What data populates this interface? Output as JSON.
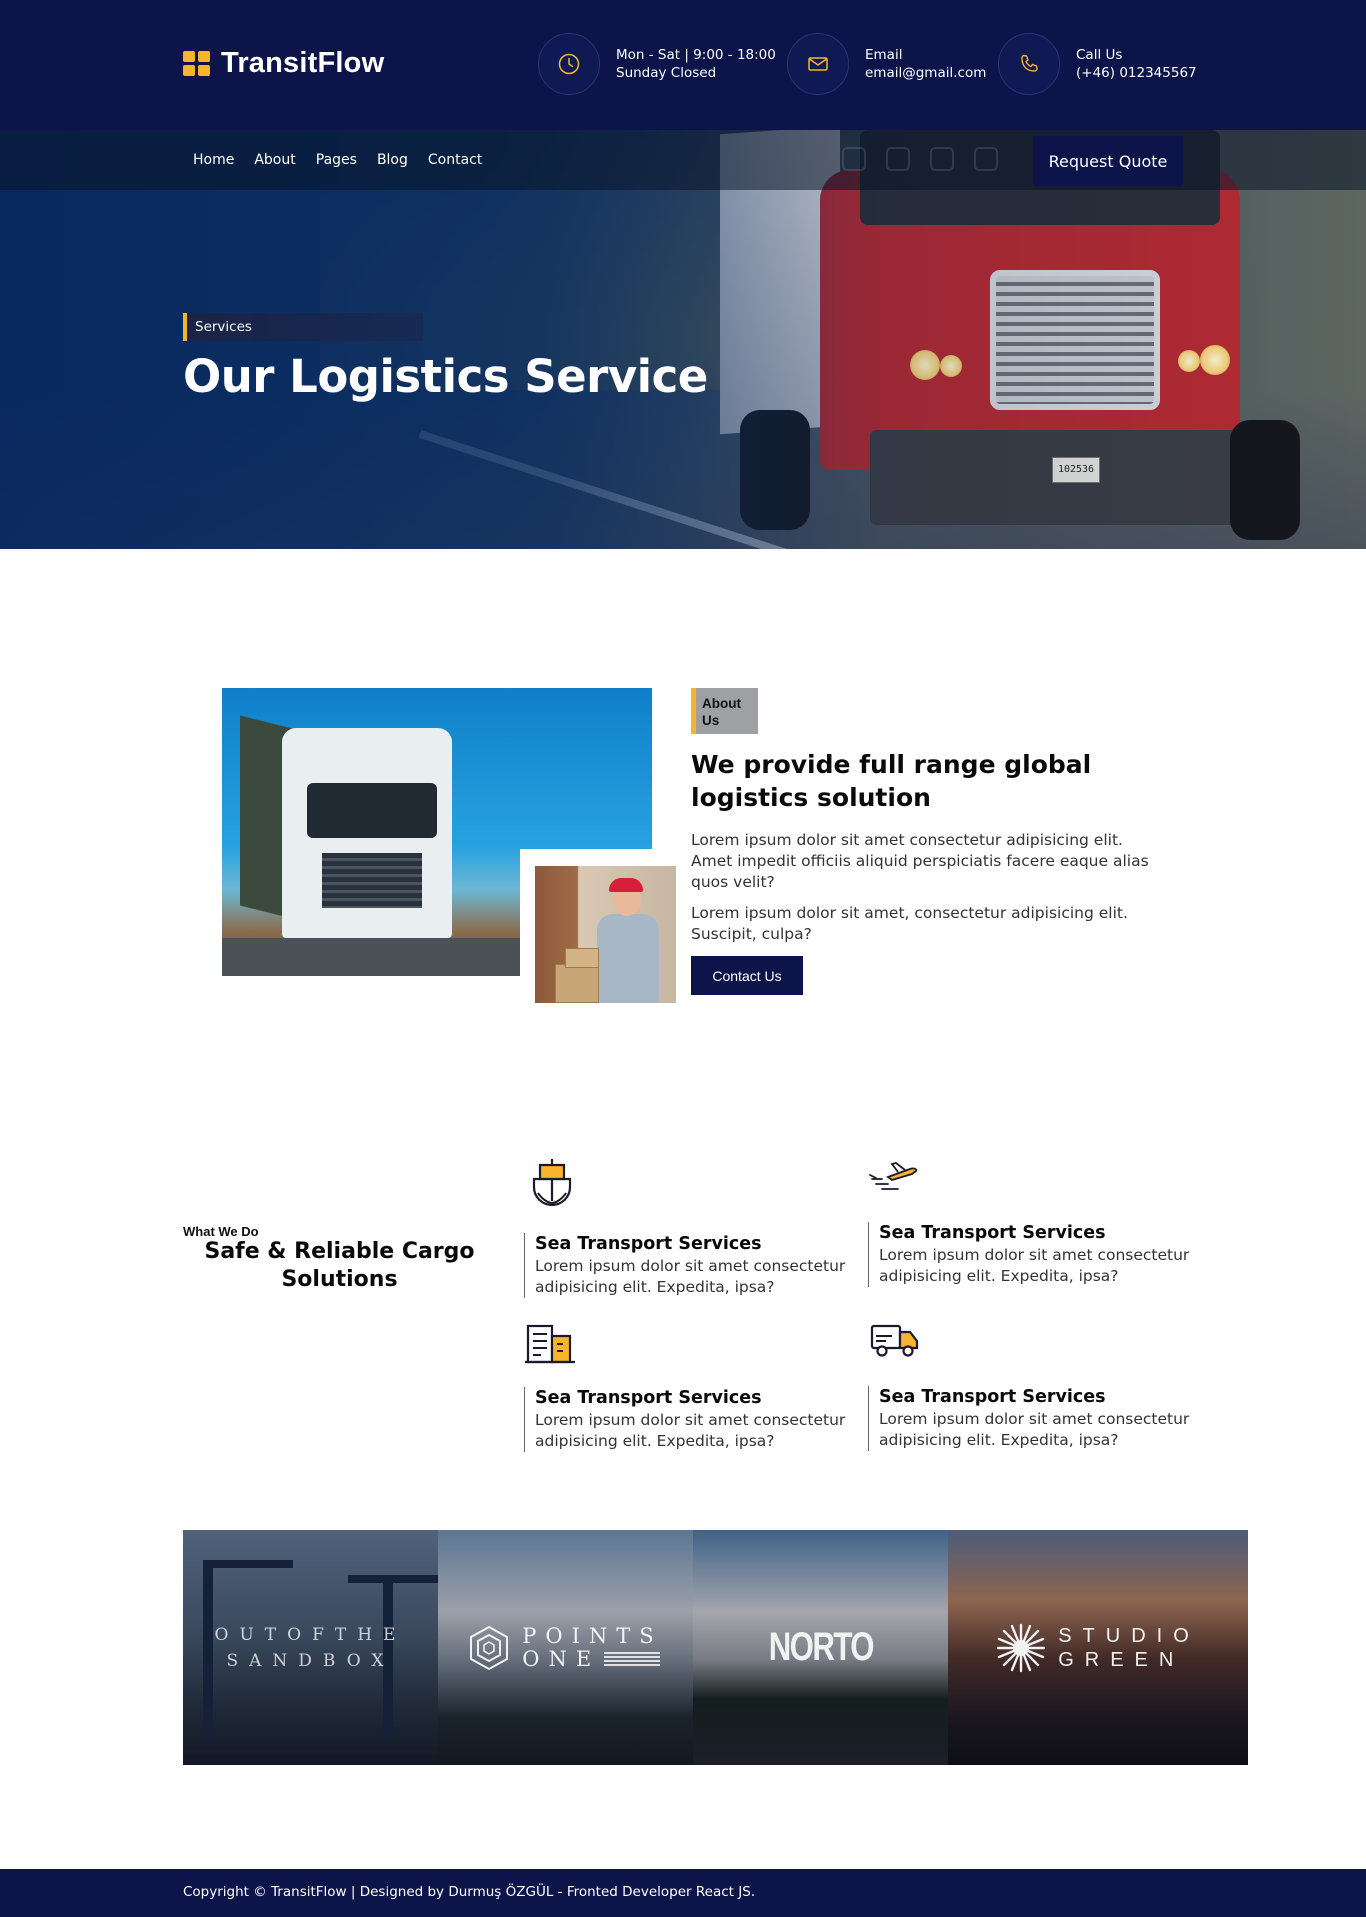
{
  "brand": {
    "name": "TransitFlow",
    "accent": "#f6b52b",
    "primary": "#0c1449"
  },
  "header": {
    "hours": {
      "line1": "Mon - Sat | 9:00 - 18:00",
      "line2": "Sunday Closed",
      "icon": "clock-icon"
    },
    "email": {
      "label": "Email",
      "value": "email@gmail.com",
      "icon": "mail-icon"
    },
    "phone": {
      "label": "Call Us",
      "value": "(+46) 012345567",
      "icon": "phone-icon"
    }
  },
  "nav": {
    "items": [
      "Home",
      "About",
      "Pages",
      "Blog",
      "Contact"
    ],
    "socials": [
      "linkedin-icon",
      "dribbble-icon",
      "instagram-icon",
      "facebook-icon"
    ],
    "cta": "Request Quote"
  },
  "hero": {
    "tag": "Services",
    "title": "Our Logistics Service",
    "plate": "102536"
  },
  "about": {
    "tag": "About Us",
    "title": "We provide full range global logistics solution",
    "p1": "Lorem ipsum dolor sit amet consectetur adipisicing elit. Amet impedit officiis aliquid perspiciatis facere eaque alias quos velit?",
    "p2": "Lorem ipsum dolor sit amet, consectetur adipisicing elit. Suscipit, culpa?",
    "button": "Contact Us"
  },
  "services": {
    "kicker": "What We Do",
    "title": "Safe & Reliable Cargo Solutions",
    "items": [
      {
        "icon": "ship-icon",
        "title": "Sea Transport Services",
        "desc": "Lorem ipsum dolor sit amet consectetur adipisicing elit. Expedita, ipsa?"
      },
      {
        "icon": "airplane-icon",
        "title": "Sea Transport Services",
        "desc": "Lorem ipsum dolor sit amet consectetur adipisicing elit. Expedita, ipsa?"
      },
      {
        "icon": "warehouse-icon",
        "title": "Sea Transport Services",
        "desc": "Lorem ipsum dolor sit amet consectetur adipisicing elit. Expedita, ipsa?"
      },
      {
        "icon": "delivery-truck-icon",
        "title": "Sea Transport Services",
        "desc": "Lorem ipsum dolor sit amet consectetur adipisicing elit. Expedita, ipsa?"
      }
    ]
  },
  "partners": [
    {
      "line1": "OUTOFTHE",
      "line2": "SANDBOX"
    },
    {
      "line1": "POINTS",
      "line2": "ONE"
    },
    {
      "line1": "NORTO",
      "line2": ""
    },
    {
      "line1": "STUDIO",
      "line2": "GREEN"
    }
  ],
  "footer": {
    "text": "Copyright © TransitFlow | Designed by Durmuş ÖZGÜL - Fronted Developer React JS."
  }
}
